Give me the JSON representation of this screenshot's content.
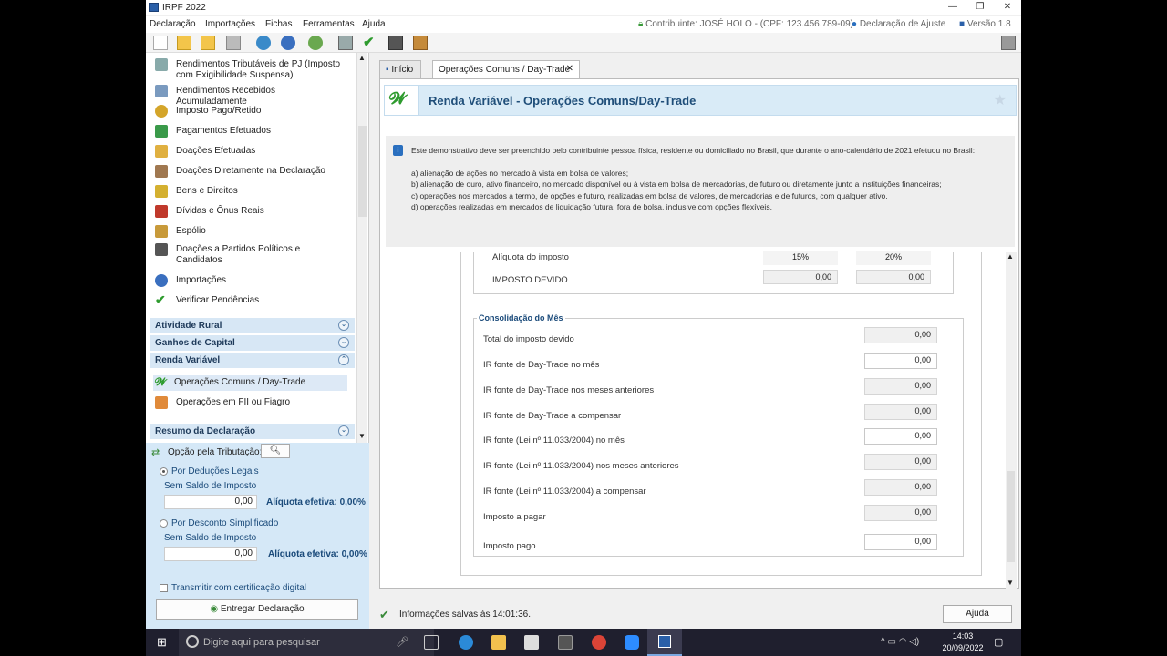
{
  "window": {
    "title": "IRPF 2022"
  },
  "menu": [
    "Declaração",
    "Importações",
    "Fichas",
    "Ferramentas",
    "Ajuda"
  ],
  "header_info": {
    "contribuinte": "Contribuinte: JOSÉ HOLO - (CPF: 123.456.789-09)",
    "tipo": "Declaração de Ajuste",
    "versao": "Versão 1.8"
  },
  "sidebar": {
    "items": [
      {
        "label": "Rendimentos Tributáveis de PJ (Imposto com Exigibilidade Suspensa)",
        "icon": "building-icon"
      },
      {
        "label": "Rendimentos Recebidos Acumuladamente",
        "icon": "money-stack-icon"
      },
      {
        "label": "Imposto Pago/Retido",
        "icon": "coins-icon"
      },
      {
        "label": "Pagamentos Efetuados",
        "icon": "card-icon"
      },
      {
        "label": "Doações Efetuadas",
        "icon": "donation-icon"
      },
      {
        "label": "Doações Diretamente na Declaração",
        "icon": "gift-icon"
      },
      {
        "label": "Bens e Direitos",
        "icon": "goods-icon"
      },
      {
        "label": "Dívidas e Ônus Reais",
        "icon": "debt-icon"
      },
      {
        "label": "Espólio",
        "icon": "estate-icon"
      },
      {
        "label": "Doações a Partidos Políticos e Candidatos",
        "icon": "party-icon"
      },
      {
        "label": "Importações",
        "icon": "import-icon"
      },
      {
        "label": "Verificar Pendências",
        "icon": "check-icon"
      }
    ],
    "sections": [
      "Atividade Rural",
      "Ganhos de Capital",
      "Renda Variável"
    ],
    "renda_items": [
      "Operações Comuns / Day-Trade",
      "Operações em FII ou Fiagro"
    ],
    "resumo": "Resumo da Declaração"
  },
  "tributacao": {
    "label": "Opção pela Tributação:",
    "opt1": "Por Deduções Legais",
    "sub1": "Sem Saldo de Imposto",
    "val1": "0,00",
    "aliq1": "Alíquota efetiva: 0,00%",
    "opt2": "Por Desconto Simplificado",
    "sub2": "Sem Saldo de Imposto",
    "val2": "0,00",
    "aliq2": "Alíquota efetiva: 0,00%",
    "transmit": "Transmitir com certificação digital",
    "entregar": "Entregar Declaração"
  },
  "tabs": [
    "Início",
    "Operações Comuns / Day-Trade"
  ],
  "page": {
    "title": "Renda Variável - Operações Comuns/Day-Trade"
  },
  "info": {
    "intro": "Este demonstrativo deve ser preenchido pelo contribuinte pessoa física, residente ou domiciliado no Brasil, que durante o ano-calendário de 2021 efetuou no Brasil:",
    "a": "a) alienação de ações no mercado à vista em bolsa de valores;",
    "b": "b) alienação de ouro, ativo financeiro, no mercado disponível ou à vista em bolsa de mercadorias, de futuro ou diretamente junto a instituições financeiras;",
    "c": "c) operações nos mercados a termo, de opções e futuro, realizadas em bolsa de valores, de mercadorias e de futuros, com qualquer ativo.",
    "d": "d) operações realizadas em mercados de liquidação futura, fora de bolsa, inclusive com opções flexíveis."
  },
  "aliquota": {
    "label": "Alíquota do imposto",
    "v1": "15%",
    "v2": "20%"
  },
  "imposto_devido": {
    "label": "IMPOSTO DEVIDO",
    "v1": "0,00",
    "v2": "0,00"
  },
  "consolidacao": {
    "title": "Consolidação do Mês",
    "rows": [
      {
        "label": "Total do imposto devido",
        "value": "0,00"
      },
      {
        "label": "IR fonte de Day-Trade no mês",
        "value": "0,00"
      },
      {
        "label": "IR fonte de Day-Trade nos meses anteriores",
        "value": "0,00"
      },
      {
        "label": "IR fonte de Day-Trade a compensar",
        "value": "0,00"
      },
      {
        "label": "IR fonte (Lei nº 11.033/2004) no mês",
        "value": "0,00"
      },
      {
        "label": "IR fonte (Lei nº 11.033/2004) nos meses anteriores",
        "value": "0,00"
      },
      {
        "label": "IR fonte (Lei nº 11.033/2004) a compensar",
        "value": "0,00"
      },
      {
        "label": "Imposto a pagar",
        "value": "0,00"
      },
      {
        "label": "Imposto pago",
        "value": "0,00"
      }
    ]
  },
  "status": {
    "saved": "Informações salvas às 14:01:36.",
    "ajuda": "Ajuda"
  },
  "taskbar": {
    "search": "Digite aqui para pesquisar",
    "time": "14:03",
    "date": "20/09/2022"
  },
  "colors": {
    "accent": "#1f4e79",
    "sidebar_section": "#d7e7f5",
    "tributacao_bg": "#d5e8f7"
  }
}
